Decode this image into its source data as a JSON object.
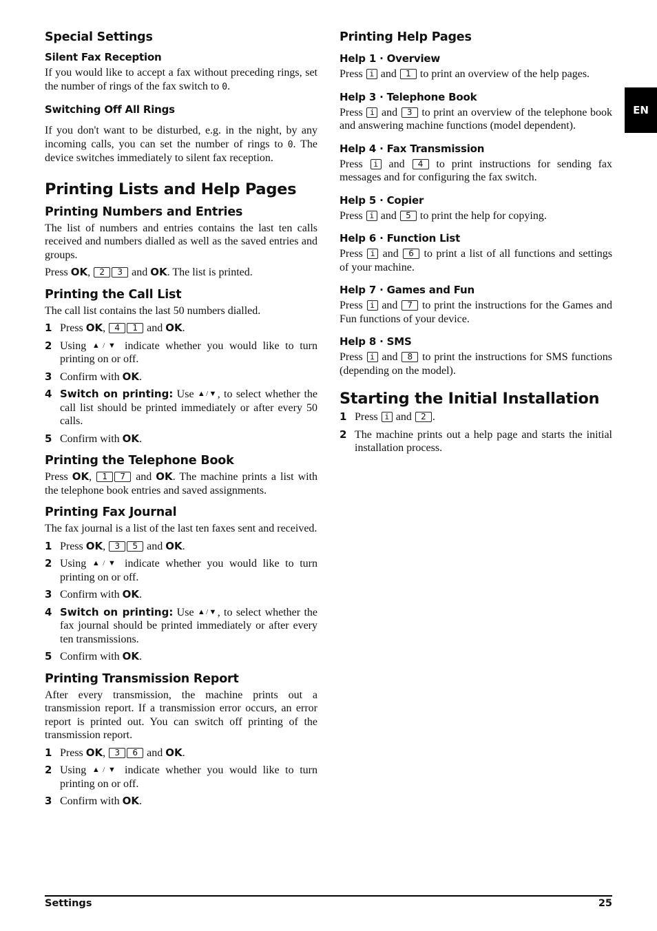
{
  "side_tab": "EN",
  "footer": {
    "section": "Settings",
    "page_number": "25"
  },
  "left": {
    "special_settings": {
      "title": "Special Settings",
      "silent_fax": {
        "title": "Silent Fax Reception",
        "text_a": "If you would like to accept a fax without preceding rings, set the number of rings of the fax switch to ",
        "digit": "0",
        "text_b": "."
      },
      "switching_off": {
        "title": "Switching Off All Rings",
        "text_a": "If you don't want to be disturbed, e.g. in the night, by any incoming calls, you can set the number of rings to ",
        "digit": "0",
        "text_b": ". The device switches immediately to silent fax reception."
      }
    },
    "printing_lists": {
      "title": "Printing Lists and Help Pages",
      "numbers_entries": {
        "title": "Printing Numbers and Entries",
        "text": "The list of numbers and entries contains the last ten calls received and numbers dialled as well as the saved entries and groups.",
        "press": "Press ",
        "ok": "OK",
        "comma": ", ",
        "keys": [
          "2",
          "3"
        ],
        "and": " and ",
        "end": ". The list is printed."
      },
      "call_list": {
        "title": "Printing the Call List",
        "text": "The call list contains the last 50 numbers dialled.",
        "steps": [
          {
            "num": "1",
            "press": "Press ",
            "ok": "OK",
            "keys": [
              "4",
              "1"
            ],
            "and": " and ",
            "end": "."
          },
          {
            "num": "2",
            "a": "Using ",
            "arrows": "▲/▼",
            "b": " indicate whether you would like to turn printing on or off."
          },
          {
            "num": "3",
            "a": "Confirm with ",
            "ok": "OK",
            "b": "."
          },
          {
            "num": "4",
            "bold": "Switch on printing:",
            "a": " Use ",
            "arrows": "▲/▼",
            "b": ", to select whether the call list should be printed immediately or after every 50 calls."
          },
          {
            "num": "5",
            "a": "Confirm with ",
            "ok": "OK",
            "b": "."
          }
        ]
      },
      "telephone_book": {
        "title": "Printing the Telephone Book",
        "press": "Press ",
        "ok": "OK",
        "keys": [
          "1",
          "7"
        ],
        "and": " and ",
        "end": ". The machine prints a list with the telephone book entries and saved assignments."
      },
      "fax_journal": {
        "title": "Printing Fax Journal",
        "text": "The fax journal is a list of the last ten faxes sent and received.",
        "steps": [
          {
            "num": "1",
            "press": "Press ",
            "ok": "OK",
            "keys": [
              "3",
              "5"
            ],
            "and": " and ",
            "end": "."
          },
          {
            "num": "2",
            "a": "Using ",
            "arrows": "▲/▼",
            "b": " indicate whether you would like to turn printing on or off."
          },
          {
            "num": "3",
            "a": "Confirm with ",
            "ok": "OK",
            "b": "."
          },
          {
            "num": "4",
            "bold": "Switch on printing:",
            "a": " Use ",
            "arrows": "▲/▼",
            "b": ", to select whether the fax journal should be printed immediately or after every ten transmissions."
          },
          {
            "num": "5",
            "a": "Confirm with ",
            "ok": "OK",
            "b": "."
          }
        ]
      },
      "transmission_report": {
        "title": "Printing Transmission Report",
        "text": "After every transmission, the machine prints out a transmission report. If a transmission error occurs, an error report is printed out. You can switch off printing of the transmission report.",
        "steps": [
          {
            "num": "1",
            "press": "Press ",
            "ok": "OK",
            "keys": [
              "3",
              "6"
            ],
            "and": " and ",
            "end": "."
          },
          {
            "num": "2",
            "a": "Using ",
            "arrows": "▲/▼",
            "b": " indicate whether you would like to turn printing on or off."
          },
          {
            "num": "3",
            "a": "Confirm with ",
            "ok": "OK",
            "b": "."
          }
        ]
      }
    }
  },
  "right": {
    "help_pages": {
      "title": "Printing Help Pages",
      "info_key": "i",
      "items": [
        {
          "title": "Help 1 · Overview",
          "press": "Press ",
          "and": " and ",
          "key": "1",
          "text": " to print an overview of the help pages."
        },
        {
          "title": "Help 3 · Telephone Book",
          "press": "Press ",
          "and": " and ",
          "key": "3",
          "text": " to print an overview of the telephone book and answering machine functions (model dependent)."
        },
        {
          "title": "Help 4 · Fax Transmission",
          "press": "Press ",
          "and": " and ",
          "key": "4",
          "text": " to print instructions for sending fax messages and for configuring the fax switch."
        },
        {
          "title": "Help 5 · Copier",
          "press": "Press ",
          "and": " and ",
          "key": "5",
          "text": " to print the help for copying."
        },
        {
          "title": "Help 6 · Function List",
          "press": "Press ",
          "and": " and ",
          "key": "6",
          "text": " to print a list of all functions and settings of your machine."
        },
        {
          "title": "Help 7 · Games and Fun",
          "press": "Press ",
          "and": " and ",
          "key": "7",
          "text": " to print the instructions for the Games and Fun functions of your device."
        },
        {
          "title": "Help 8 · SMS",
          "press": "Press ",
          "and": " and ",
          "key": "8",
          "text": " to print the instructions for SMS functions (depending on the model)."
        }
      ]
    },
    "initial_installation": {
      "title": "Starting the Initial Installation",
      "steps": [
        {
          "num": "1",
          "press": "Press ",
          "info_key": "i",
          "and": " and ",
          "key": "2",
          "end": "."
        },
        {
          "num": "2",
          "text": "The machine prints out a help page and starts the initial installation process."
        }
      ]
    }
  }
}
